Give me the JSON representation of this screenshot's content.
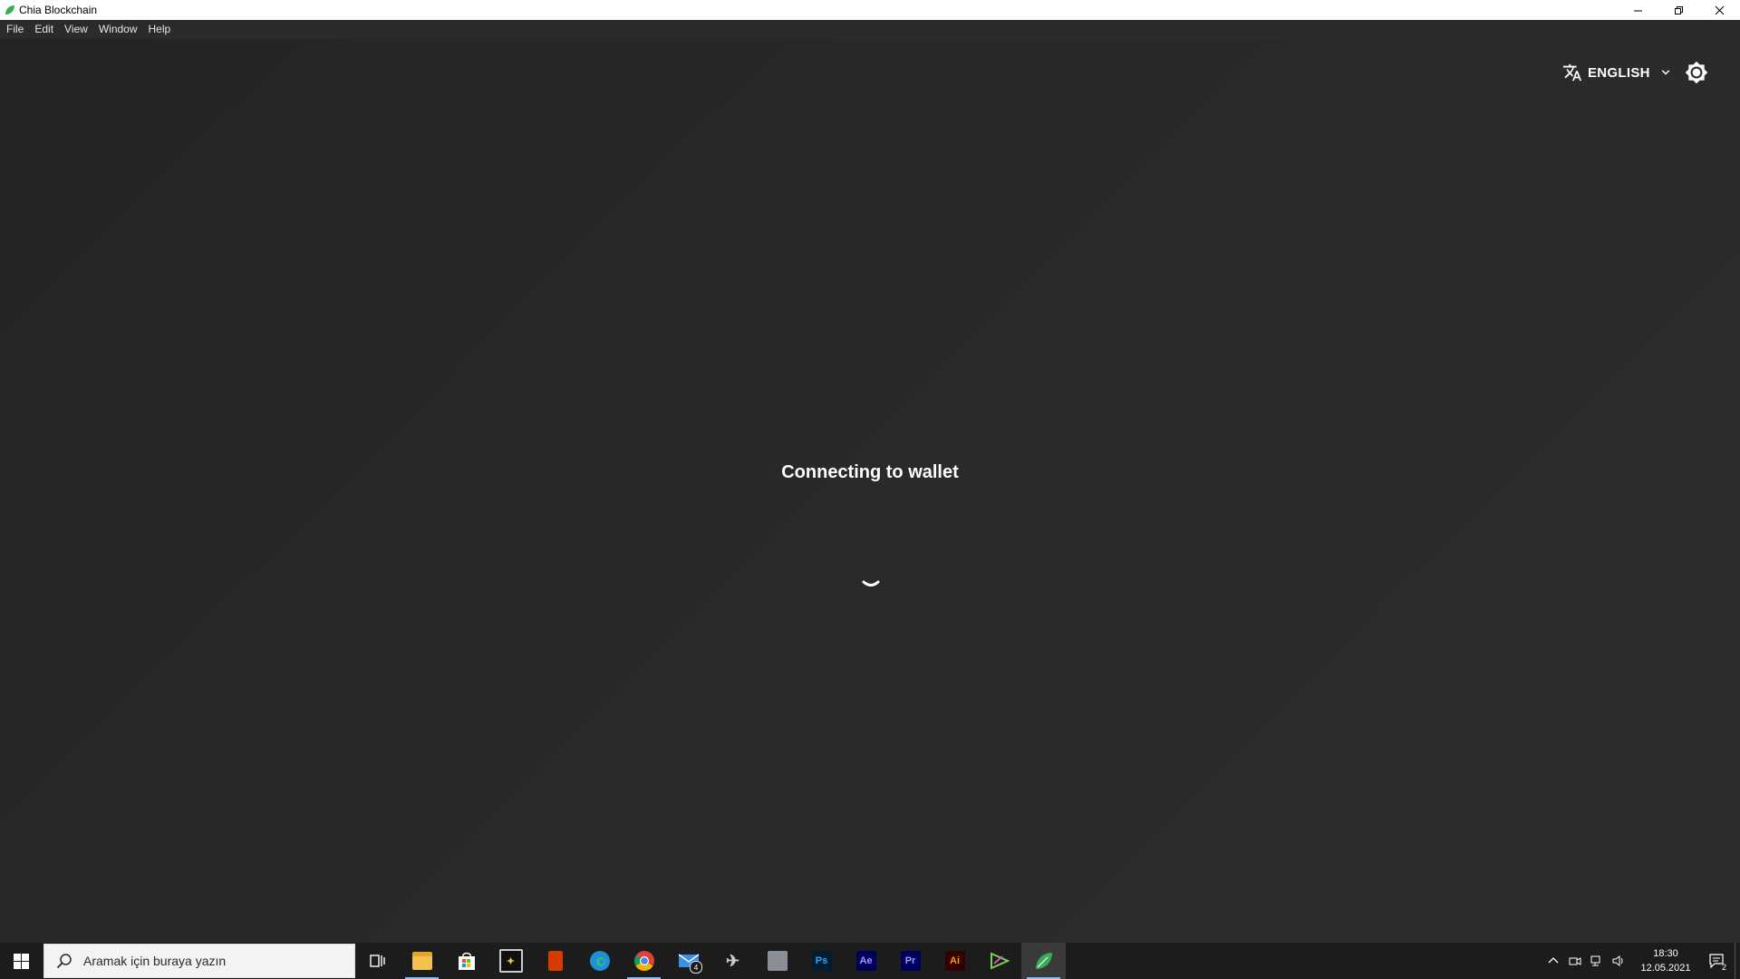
{
  "window": {
    "title": "Chia Blockchain",
    "brand_color": "#3aac59"
  },
  "menu": [
    "File",
    "Edit",
    "View",
    "Window",
    "Help"
  ],
  "header": {
    "language_label": "ENGLISH"
  },
  "main": {
    "status_text": "Connecting to wallet"
  },
  "taskbar": {
    "search_placeholder": "Aramak için buraya yazın",
    "apps": [
      {
        "name": "task-view-icon"
      },
      {
        "name": "file-explorer-icon",
        "running": true
      },
      {
        "name": "microsoft-store-icon"
      },
      {
        "name": "app-icon"
      },
      {
        "name": "office-icon"
      },
      {
        "name": "edge-icon"
      },
      {
        "name": "chrome-icon",
        "running": true
      },
      {
        "name": "mail-icon",
        "badge": "4"
      },
      {
        "name": "app-icon"
      },
      {
        "name": "app-icon"
      },
      {
        "name": "photoshop-icon",
        "label": "Ps"
      },
      {
        "name": "after-effects-icon",
        "label": "Ae"
      },
      {
        "name": "premiere-icon",
        "label": "Pr"
      },
      {
        "name": "illustrator-icon",
        "label": "Ai"
      },
      {
        "name": "app-icon"
      },
      {
        "name": "chia-icon",
        "active": true
      }
    ],
    "clock_time": "18:30",
    "clock_date": "12.05.2021",
    "notification_count": "2"
  }
}
